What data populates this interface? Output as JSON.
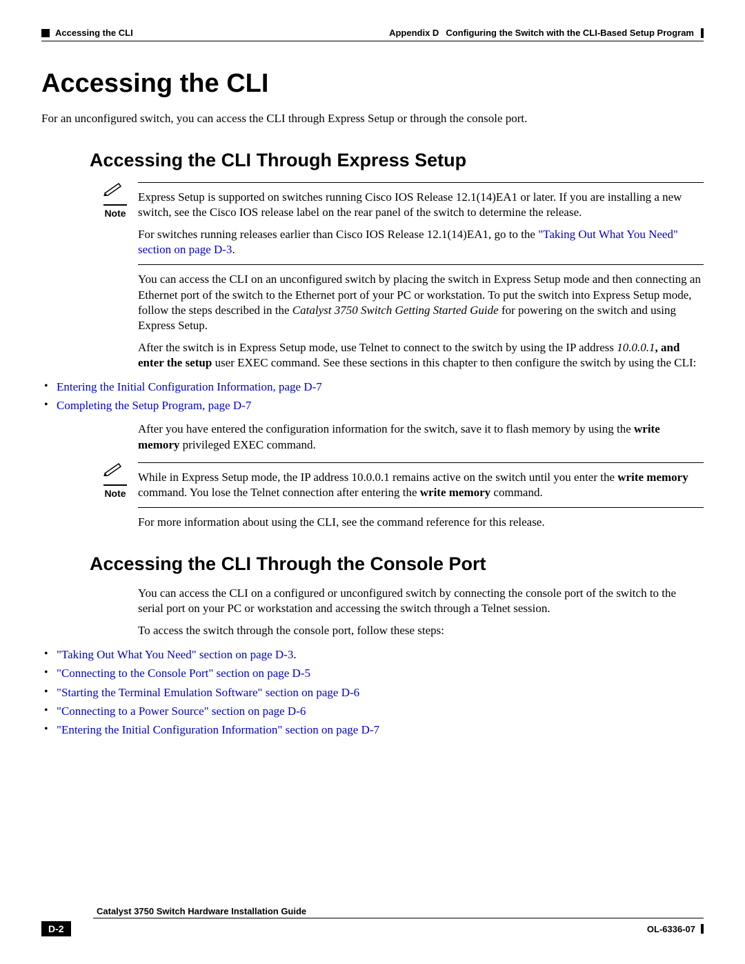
{
  "header": {
    "left": "Accessing the CLI",
    "appendix": "Appendix D",
    "title": "Configuring the Switch with the CLI-Based Setup Program"
  },
  "h1": "Accessing the CLI",
  "intro": "For an unconfigured switch, you can access the CLI through Express Setup or through the console port.",
  "h2a": "Accessing the CLI Through Express Setup",
  "note1": {
    "label": "Note",
    "text": "Express Setup is supported on switches running Cisco IOS Release 12.1(14)EA1 or later. If you are installing a new switch, see the Cisco IOS release label on the rear panel of the switch to determine the release.",
    "text2a": "For switches running releases earlier than Cisco IOS Release 12.1(14)EA1, go to the ",
    "link2": "\"Taking Out What You Need\" section on page D-3",
    "text2b": "."
  },
  "p1": {
    "a": "You can access the CLI on an unconfigured switch by placing the switch in Express Setup mode and then connecting an Ethernet port of the switch to the Ethernet port of your PC or workstation. To put the switch into Express Setup mode, follow the steps described in the ",
    "italic": "Catalyst 3750 Switch Getting Started Guide",
    "b": " for powering on the switch and using Express Setup."
  },
  "p2": {
    "a": "After the switch is in Express Setup mode, use Telnet to connect to the switch by using the IP address ",
    "ip": "10.0.0.1",
    "b": ", and enter the ",
    "cmd": "setup",
    "c": " user EXEC command. See these sections in this chapter to then configure the switch by using the CLI:"
  },
  "bullets1": {
    "a": "Entering the Initial Configuration Information, page D-7",
    "b": "Completing the Setup Program, page D-7"
  },
  "p3": {
    "a": "After you have entered the configuration information for the switch, save it to flash memory by using the ",
    "cmd": "write memory",
    "b": " privileged EXEC command."
  },
  "note2": {
    "label": "Note",
    "a": "While in Express Setup mode, the IP address 10.0.0.1 remains active on the switch until you enter the ",
    "cmd1": "write memory",
    "b": " command. You lose the Telnet connection after entering the ",
    "cmd2": "write memory",
    "c": " command."
  },
  "p4": "For more information about using the CLI, see the command reference for this release.",
  "h2b": "Accessing the CLI Through the Console Port",
  "p5": "You can access the CLI on a configured or unconfigured switch by connecting the console port of the switch to the serial port on your PC or workstation and accessing the switch through a Telnet session.",
  "p6": "To access the switch through the console port, follow these steps:",
  "bullets2": {
    "a": "\"Taking Out What You Need\" section on page D-3",
    "adot": ".",
    "b": "\"Connecting to the Console Port\" section on page D-5",
    "c": "\"Starting the Terminal Emulation Software\" section on page D-6",
    "d": "\"Connecting to a Power Source\" section on page D-6",
    "e": "\"Entering the Initial Configuration Information\" section on page D-7"
  },
  "footer": {
    "title": "Catalyst 3750 Switch Hardware Installation Guide",
    "page": "D-2",
    "doc": "OL-6336-07"
  }
}
